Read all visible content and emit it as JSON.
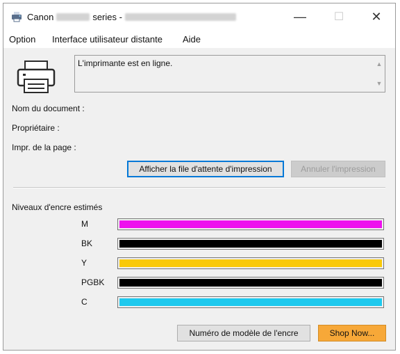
{
  "window": {
    "title_prefix": "Canon",
    "title_series": "series -",
    "minimize_glyph": "—",
    "maximize_glyph": "☐",
    "close_glyph": "✕"
  },
  "menu": {
    "items": [
      {
        "label": "Option"
      },
      {
        "label": "Interface utilisateur distante"
      },
      {
        "label": "Aide"
      }
    ]
  },
  "status": {
    "message": "L'imprimante est en ligne."
  },
  "document": {
    "name_label": "Nom du document :",
    "owner_label": "Propriétaire :",
    "pages_label": "Impr. de la page :"
  },
  "buttons": {
    "show_queue": "Afficher la file d'attente d'impression",
    "cancel_print": "Annuler l'impression",
    "ink_model": "Numéro de modèle de l'encre",
    "shop_now": "Shop Now..."
  },
  "ink": {
    "section_label": "Niveaux d'encre estimés",
    "levels": [
      {
        "name": "M",
        "color": "#ee10ee",
        "level": 1.0
      },
      {
        "name": "BK",
        "color": "#000000",
        "level": 1.0
      },
      {
        "name": "Y",
        "color": "#f9c908",
        "level": 1.0
      },
      {
        "name": "PGBK",
        "color": "#000000",
        "level": 1.0
      },
      {
        "name": "C",
        "color": "#1ec9ee",
        "level": 1.0
      }
    ]
  },
  "icons": {
    "app": "canon-printer-icon",
    "printer": "printer-icon"
  }
}
